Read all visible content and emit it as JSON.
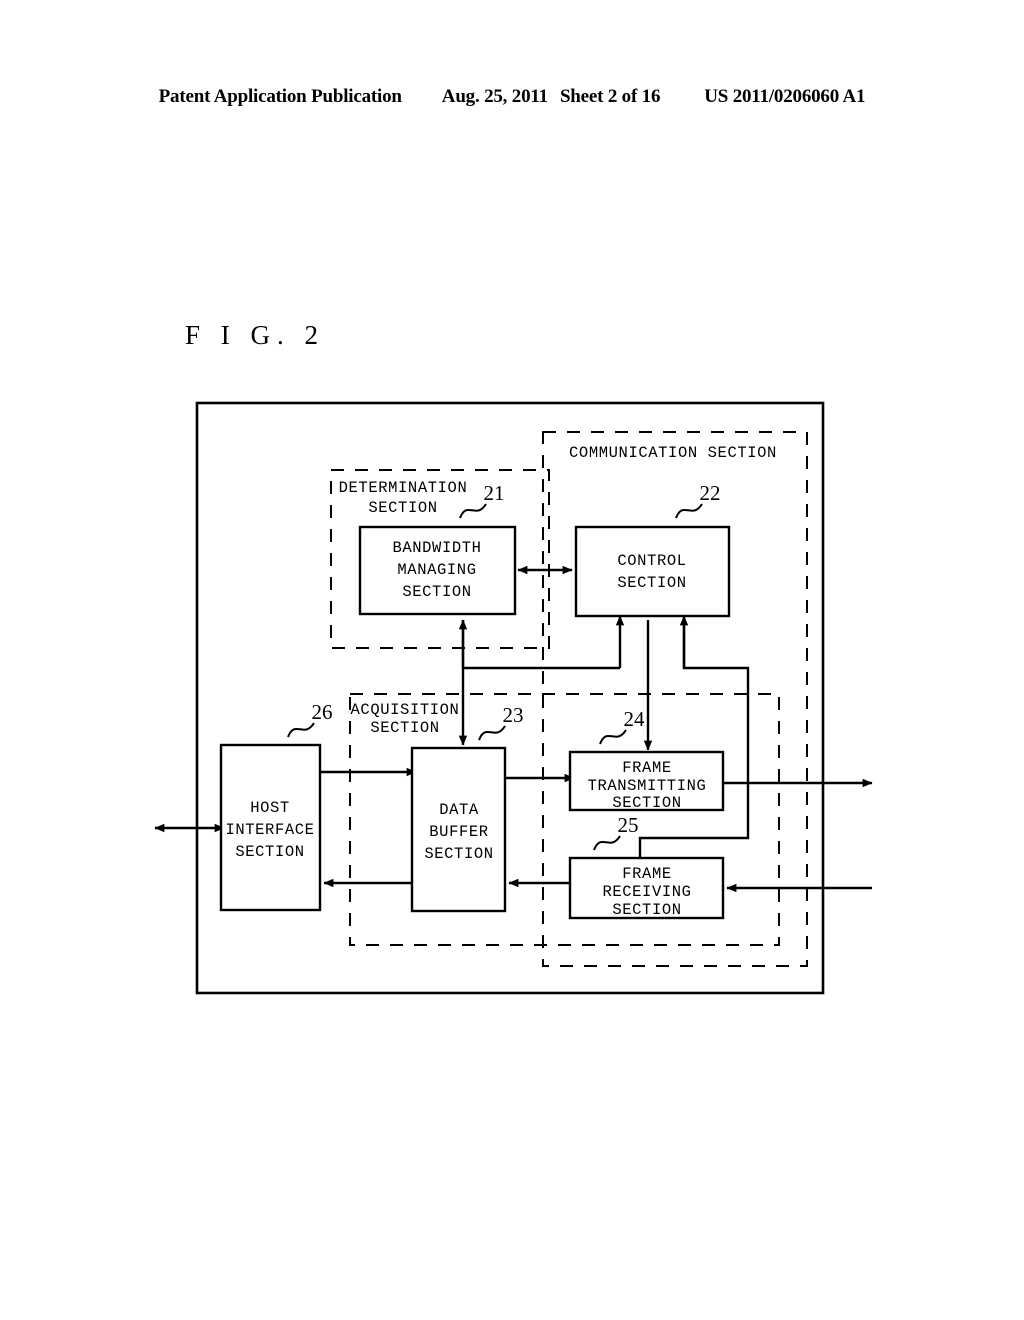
{
  "header": {
    "publication": "Patent Application Publication",
    "date": "Aug. 25, 2011",
    "sheet": "Sheet 2 of 16",
    "patent_number": "US 2011/0206060 A1"
  },
  "figure": {
    "label": "F I G.  2"
  },
  "diagram": {
    "groups": {
      "determination": {
        "line1": "DETERMINATION",
        "line2": "SECTION"
      },
      "communication": {
        "line1": "COMMUNICATION SECTION"
      },
      "acquisition": {
        "line1": "ACQUISITION",
        "line2": "SECTION"
      }
    },
    "blocks": [
      {
        "id": "bandwidth-managing-section",
        "ref": "21",
        "lines": [
          "BANDWIDTH",
          "MANAGING",
          "SECTION"
        ]
      },
      {
        "id": "control-section",
        "ref": "22",
        "lines": [
          "CONTROL",
          "SECTION"
        ]
      },
      {
        "id": "data-buffer-section",
        "ref": "23",
        "lines": [
          "DATA",
          "BUFFER",
          "SECTION"
        ]
      },
      {
        "id": "frame-transmitting-section",
        "ref": "24",
        "lines": [
          "FRAME",
          "TRANSMITTING",
          "SECTION"
        ]
      },
      {
        "id": "frame-receiving-section",
        "ref": "25",
        "lines": [
          "FRAME",
          "RECEIVING",
          "SECTION"
        ]
      },
      {
        "id": "host-interface-section",
        "ref": "26",
        "lines": [
          "HOST",
          "INTERFACE",
          "SECTION"
        ]
      }
    ],
    "colors": {
      "ink": "#000000",
      "paper": "#ffffff"
    }
  }
}
